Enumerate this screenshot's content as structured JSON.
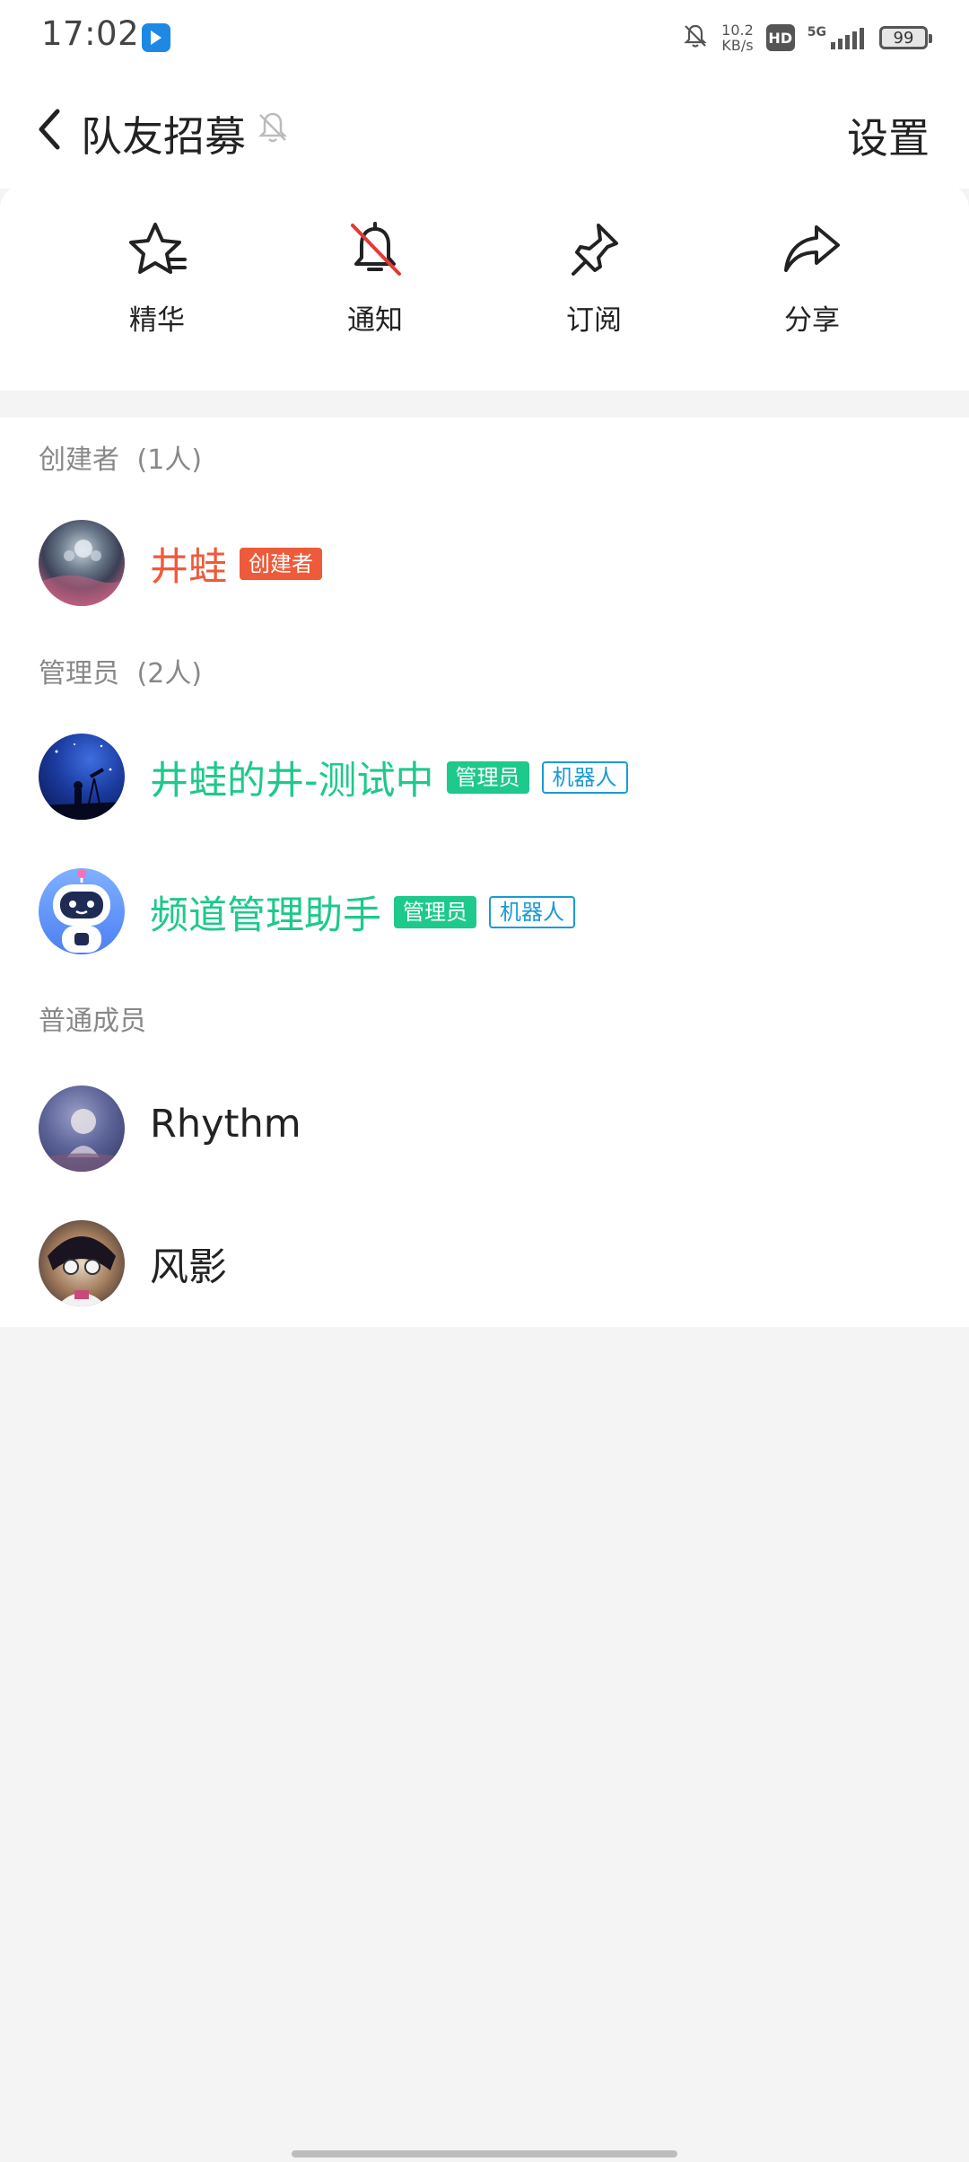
{
  "status_bar": {
    "time": "17:02",
    "net_speed_value": "10.2",
    "net_speed_unit": "KB/s",
    "hd": "HD",
    "network": "5G",
    "battery": "99"
  },
  "header": {
    "title": "队友招募",
    "settings_label": "设置"
  },
  "actions": [
    {
      "label": "精华",
      "icon": "star-icon"
    },
    {
      "label": "通知",
      "icon": "bell-off-icon"
    },
    {
      "label": "订阅",
      "icon": "pin-icon"
    },
    {
      "label": "分享",
      "icon": "share-icon"
    }
  ],
  "sections": {
    "creators": {
      "title": "创建者",
      "count": "(1人)"
    },
    "admins": {
      "title": "管理员",
      "count": "(2人)"
    },
    "normal": {
      "title": "普通成员"
    }
  },
  "members": {
    "creator": {
      "name": "井蛙",
      "tag": "创建者"
    },
    "admins": [
      {
        "name": "井蛙的井-测试中",
        "tag": "管理员",
        "bot_tag": "机器人"
      },
      {
        "name": "频道管理助手",
        "tag": "管理员",
        "bot_tag": "机器人"
      }
    ],
    "normal": [
      {
        "name": "Rhythm"
      },
      {
        "name": "风影"
      }
    ]
  },
  "colors": {
    "creator": "#ee5a3a",
    "admin": "#1ec98c",
    "bot": "#1b9bd6"
  }
}
